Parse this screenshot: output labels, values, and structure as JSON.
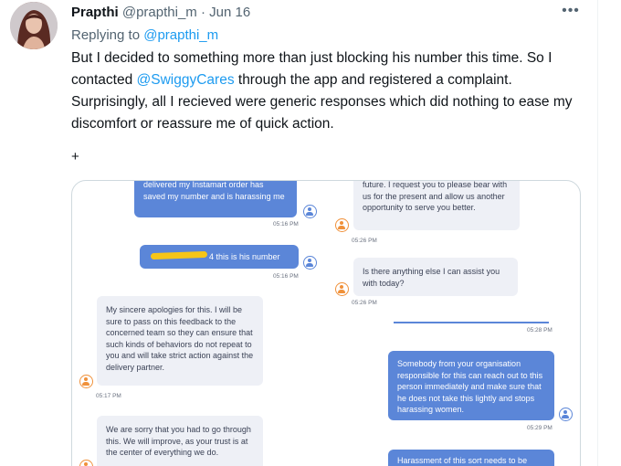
{
  "tweet": {
    "author_name": "Prapthi",
    "author_handle": "@prapthi_m",
    "separator": "·",
    "date": "Jun 16",
    "more_icon": "more-horizontal-icon",
    "replying_prefix": "Replying to",
    "replying_to": "@prapthi_m",
    "body_before": "But I decided to something more than just blocking his number this time. So I contacted ",
    "body_mention": "@SwiggyCares",
    "body_after": " through the app and registered a complaint. Surprisingly, all I recieved were generic responses which did nothing to ease my discomfort or reassure me of quick action.",
    "plus": "+"
  },
  "chat": {
    "left_column": [
      {
        "from": "user",
        "text": "delivered my Instamart order has saved my number and is harassing me",
        "time": "05:16 PM"
      },
      {
        "from": "user",
        "text": "4 this is his number",
        "time": "05:16 PM"
      },
      {
        "from": "agent",
        "text": "My sincere apologies for this. I will be sure to pass on this feedback to the concerned team so they can ensure that such kinds of behaviors do not repeat to you and will take strict action against the delivery partner.",
        "time": "05:17 PM"
      },
      {
        "from": "agent",
        "text": "We are sorry that you had to go through this. We will improve, as your trust is at the center of everything we do.",
        "time": ""
      }
    ],
    "right_column": [
      {
        "from": "agent",
        "text": "future. I request you to please bear with us for the present and allow us another opportunity to serve you better.",
        "time": "05:26 PM"
      },
      {
        "from": "agent",
        "text": "Is there anything else I can assist you with today?",
        "time": "05:26 PM"
      },
      {
        "from": "user",
        "text": "",
        "time": "05:28 PM"
      },
      {
        "from": "user",
        "text": "Somebody from your organisation responsible for this can reach out to this person immediately and make sure that he does not take this lightly and stops harassing women.",
        "time": "05:29 PM"
      },
      {
        "from": "user",
        "text": "Harassment of this sort needs to be",
        "time": ""
      }
    ]
  }
}
